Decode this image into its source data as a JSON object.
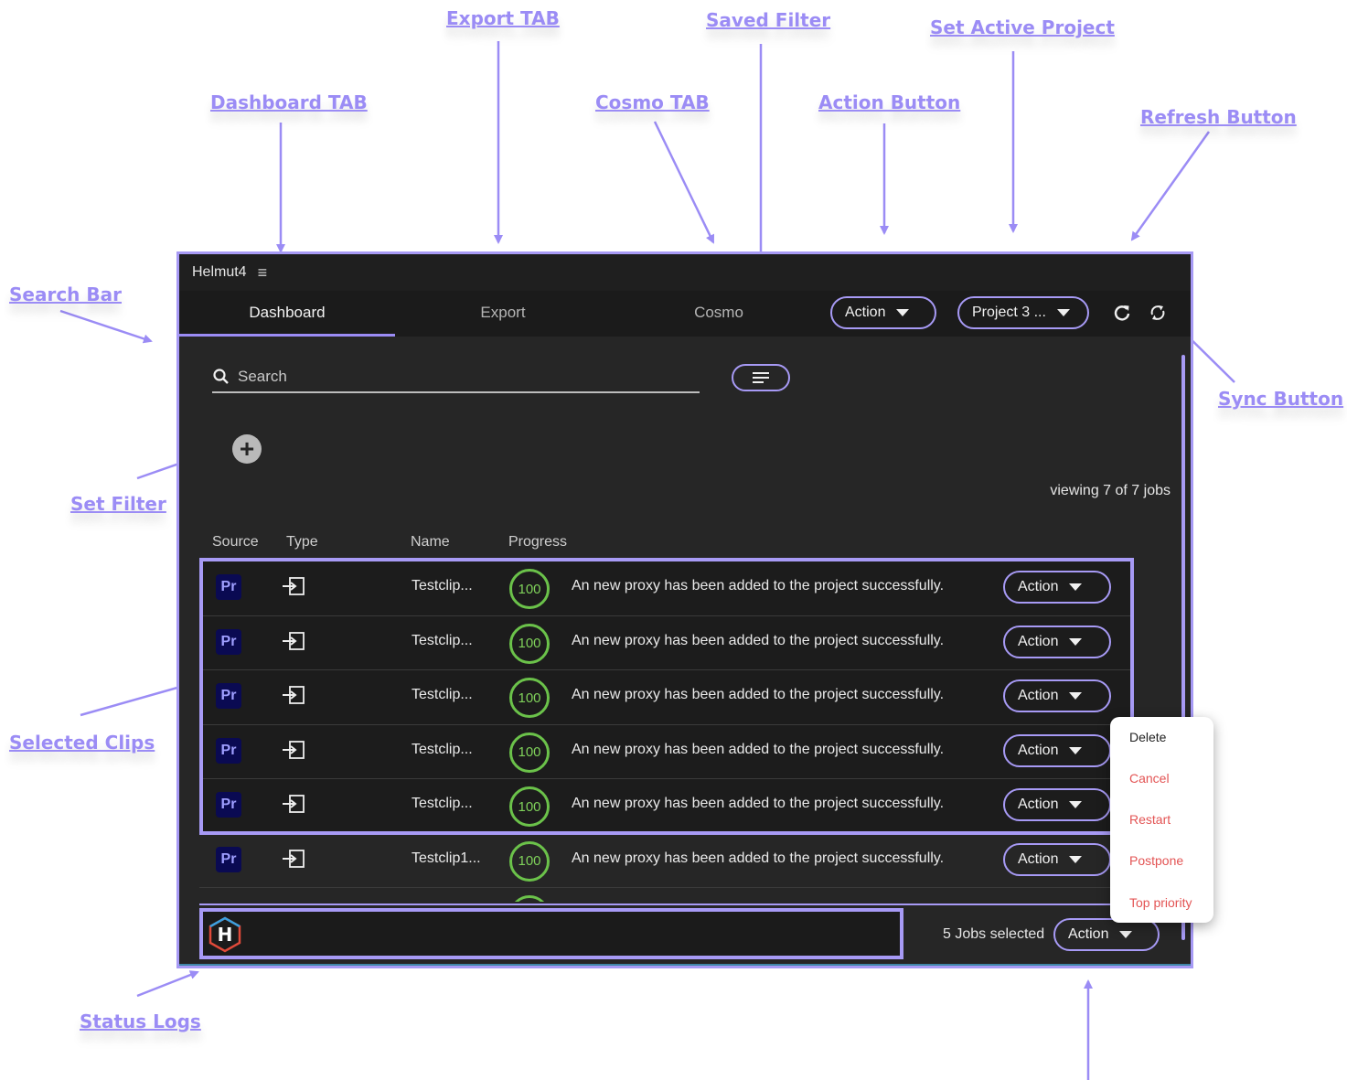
{
  "annotations": {
    "export_tab": "Export TAB",
    "saved_filter": "Saved Filter",
    "set_active_project": "Set Active Project",
    "dashboard_tab": "Dashboard TAB",
    "cosmo_tab": "Cosmo TAB",
    "action_button": "Action Button",
    "refresh_button": "Refresh Button",
    "search_bar": "Search Bar",
    "sync_button": "Sync Button",
    "set_filter": "Set Filter",
    "selected_clips": "Selected Clips",
    "status_logs": "Status Logs"
  },
  "app": {
    "title": "Helmut4",
    "tabs": [
      "Dashboard",
      "Export",
      "Cosmo"
    ],
    "active_tab": "Dashboard",
    "action_label": "Action",
    "project_label": "Project 3 ..."
  },
  "search": {
    "placeholder": "Search"
  },
  "jobs": {
    "viewing": "viewing 7 of 7 jobs",
    "columns": {
      "source": "Source",
      "type": "Type",
      "name": "Name",
      "progress": "Progress"
    },
    "rows": [
      {
        "source": "Pr",
        "name": "Testclip...",
        "progress": "100",
        "message": "An new proxy has been added to the project successfully.",
        "action": "Action"
      },
      {
        "source": "Pr",
        "name": "Testclip...",
        "progress": "100",
        "message": "An new proxy has been added to the project successfully.",
        "action": "Action"
      },
      {
        "source": "Pr",
        "name": "Testclip...",
        "progress": "100",
        "message": "An new proxy has been added to the project successfully.",
        "action": "Action"
      },
      {
        "source": "Pr",
        "name": "Testclip...",
        "progress": "100",
        "message": "An new proxy has been added to the project successfully.",
        "action": "Action"
      },
      {
        "source": "Pr",
        "name": "Testclip...",
        "progress": "100",
        "message": "An new proxy has been added to the project successfully.",
        "action": "Action"
      },
      {
        "source": "Pr",
        "name": "Testclip1...",
        "progress": "100",
        "message": "An new proxy has been added to the project successfully.",
        "action": "Action"
      }
    ],
    "selected_count": "5 Jobs selected",
    "bottom_action": "Action"
  },
  "logo": {
    "letter": "H"
  },
  "dropdown": {
    "delete": "Delete",
    "cancel": "Cancel",
    "restart": "Restart",
    "postpone": "Postpone",
    "top_priority": "Top priority"
  },
  "colors": {
    "accent": "#a79af5",
    "annotation": "#9b8cf5",
    "progress": "#6bc24a",
    "danger": "#e35454",
    "premiere": "#0a0a52"
  }
}
